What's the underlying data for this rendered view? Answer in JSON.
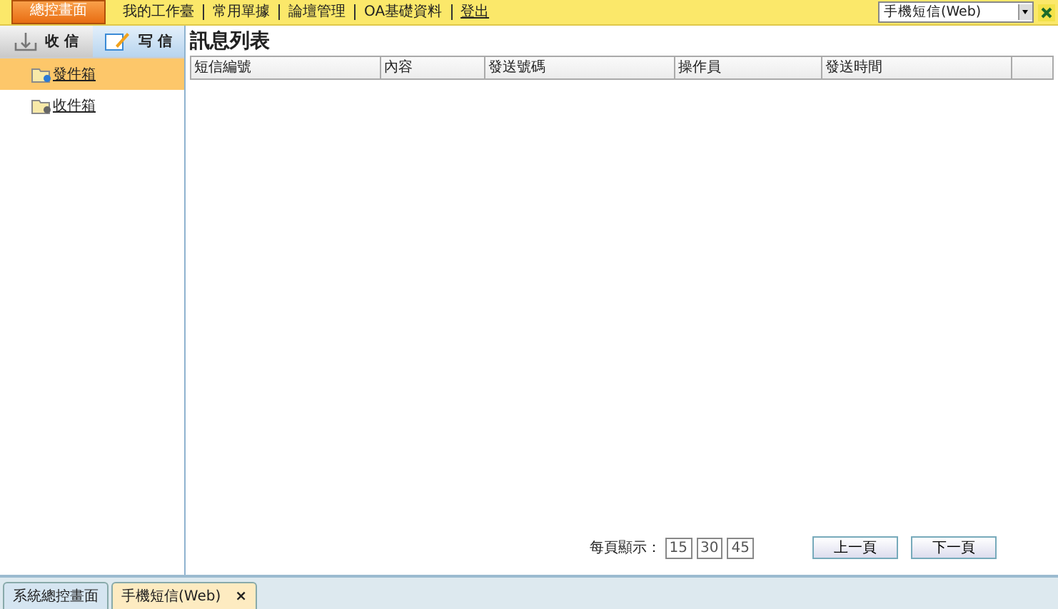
{
  "top_menu": {
    "items": [
      {
        "label": "總控畫面",
        "selected": true
      },
      {
        "label": "我的工作臺",
        "selected": false
      },
      {
        "label": "常用單據",
        "selected": false
      },
      {
        "label": "論壇管理",
        "selected": false
      },
      {
        "label": "OA基礎資料",
        "selected": false
      },
      {
        "label": "登出",
        "selected": false,
        "kind": "link"
      }
    ],
    "module_select": {
      "value": "手機短信(Web)"
    }
  },
  "sidebar": {
    "tabs": [
      {
        "label": "收 信",
        "kind": "inbox",
        "selected": false
      },
      {
        "label": "写 信",
        "kind": "compose",
        "selected": true
      }
    ],
    "items": [
      {
        "label": "發件箱",
        "selected": true
      },
      {
        "label": "收件箱",
        "selected": false
      }
    ]
  },
  "content": {
    "title": "訊息列表",
    "table": {
      "columns": [
        "短信編號",
        "內容",
        "發送號碼",
        "操作員",
        "發送時間"
      ]
    },
    "pager": {
      "label": "每頁顯示：",
      "sizes": [
        "15",
        "30",
        "45"
      ],
      "buttons": [
        "上一頁",
        "下一頁"
      ]
    }
  },
  "bottom_tabs": [
    {
      "label": "系統總控畫面",
      "selected": false
    },
    {
      "label": "手機短信(Web)",
      "selected": true,
      "close": "×"
    }
  ]
}
